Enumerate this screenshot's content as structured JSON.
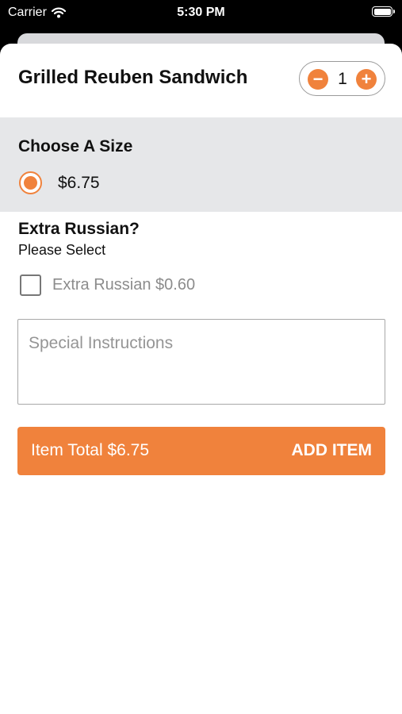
{
  "status_bar": {
    "carrier": "Carrier",
    "time": "5:30 PM"
  },
  "item": {
    "title": "Grilled Reuben Sandwich",
    "quantity": "1",
    "minus_glyph": "−",
    "plus_glyph": "+"
  },
  "size_section": {
    "heading": "Choose A Size",
    "options": [
      {
        "price": "$6.75",
        "selected": true
      }
    ]
  },
  "extras": {
    "heading": "Extra Russian?",
    "subheading": "Please Select",
    "option_label": "Extra Russian $0.60",
    "checked": false
  },
  "instructions": {
    "placeholder": "Special Instructions",
    "value": ""
  },
  "footer": {
    "total_text": "Item Total $6.75",
    "add_label": "ADD ITEM"
  },
  "colors": {
    "accent": "#f0823c",
    "section_bg": "#e6e7e9"
  }
}
